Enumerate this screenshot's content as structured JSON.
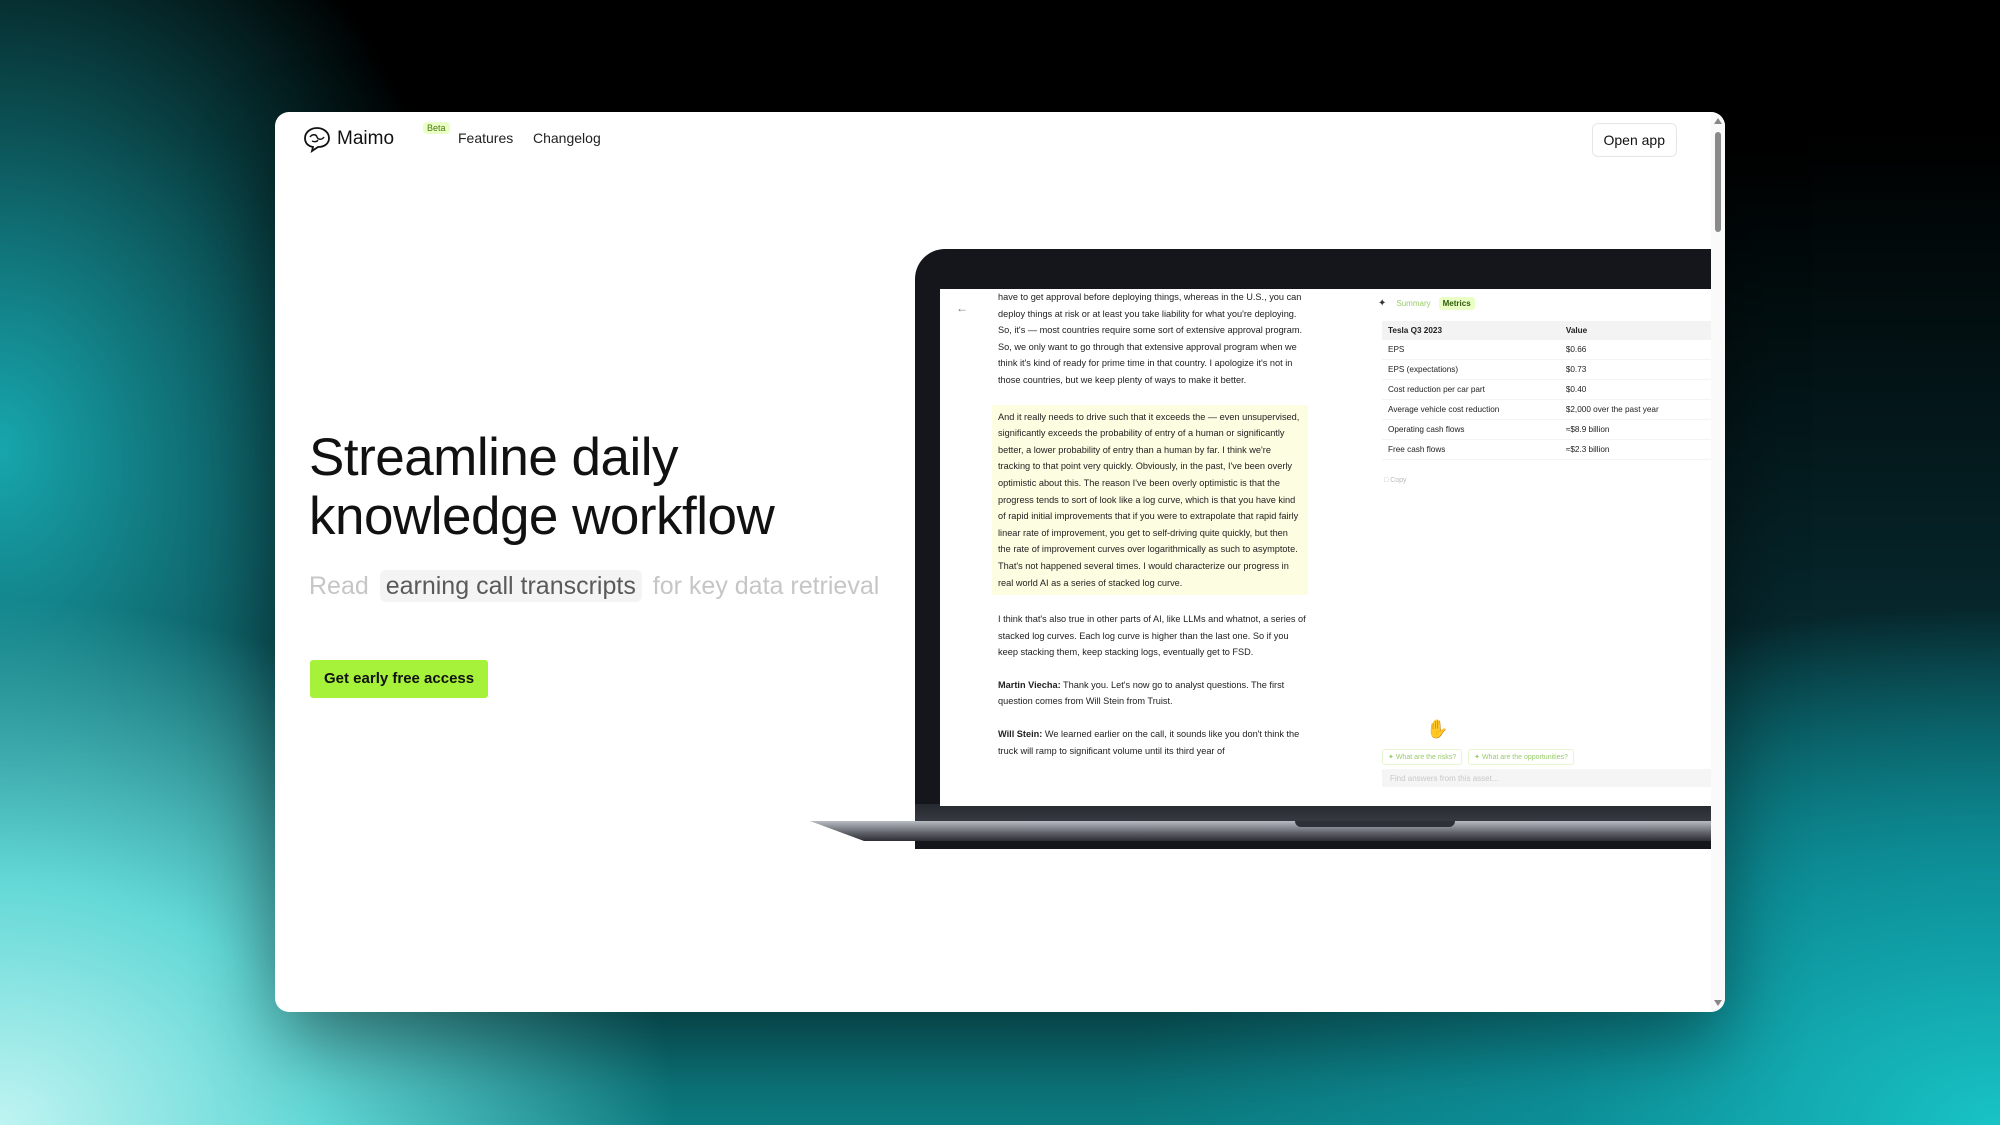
{
  "nav": {
    "brand": "Maimo",
    "beta": "Beta",
    "links": [
      "Features",
      "Changelog"
    ],
    "open_app": "Open app"
  },
  "hero": {
    "title": "Streamline daily knowledge workflow",
    "sub_prefix": "Read",
    "sub_highlight": "earning call transcripts",
    "sub_suffix": "for key data retrieval",
    "cta": "Get early free access"
  },
  "screen": {
    "back_icon": "arrow-left-icon",
    "transcript": {
      "p1": "have to get approval before deploying things, whereas in the U.S., you can deploy things at risk or at least you take liability for what you're deploying. So, it's — most countries require some sort of extensive approval program. So, we only want to go through that extensive approval program when we think it's kind of ready for prime time in that country. I apologize it's not in those countries, but we keep plenty of ways to make it better.",
      "p2": "And it really needs to drive such that it exceeds the — even unsupervised, significantly exceeds the probability of entry of a human or significantly better, a lower probability of entry than a human by far. I think we're tracking to that point very quickly. Obviously, in the past, I've been overly optimistic about this. The reason I've been overly optimistic is that the progress tends to sort of look like a log curve, which is that you have kind of rapid initial improvements that if you were to extrapolate that rapid fairly linear rate of improvement, you get to self-driving quite quickly, but then the rate of improvement curves over logarithmically as such to asymptote. That's not happened several times. I would characterize our progress in real world AI as a series of stacked log curve.",
      "p3": "I think that's also true in other parts of AI, like LLMs and whatnot, a series of stacked log curves. Each log curve is higher than the last one. So if you keep stacking them, keep stacking logs, eventually get to FSD.",
      "p4_speaker": "Martin Viecha:",
      "p4": " Thank you. Let's now go to analyst questions. The first question comes from Will Stein from Truist.",
      "p5_speaker": "Will Stein:",
      "p5": " We learned earlier on the call, it sounds like you don't think the truck will ramp to significant volume until its third year of"
    },
    "panel": {
      "tabs": [
        "Summary",
        "Metrics"
      ],
      "table_headers": [
        "Tesla Q3 2023",
        "Value"
      ],
      "rows": [
        [
          "EPS",
          "$0.66"
        ],
        [
          "EPS (expectations)",
          "$0.73"
        ],
        [
          "Cost reduction per car part",
          "$0.40"
        ],
        [
          "Average vehicle cost reduction",
          "$2,000 over the past year"
        ],
        [
          "Operating cash flows",
          "≈$8.9 billion"
        ],
        [
          "Free cash flows",
          "≈$2.3 billion"
        ]
      ],
      "copy": "Copy",
      "chips": [
        "What are the risks?",
        "What are the opportunities?"
      ],
      "ask_placeholder": "Find answers from this asset..."
    }
  }
}
